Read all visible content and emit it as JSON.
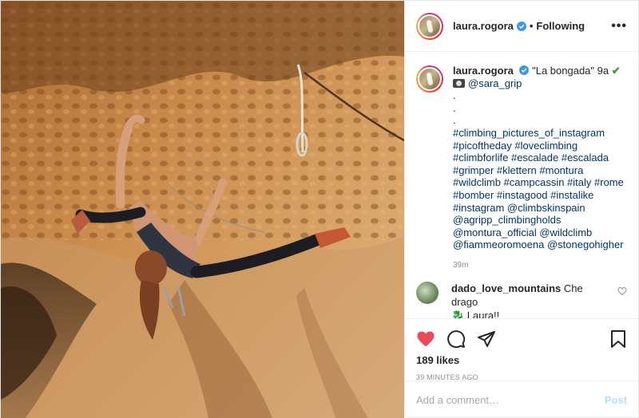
{
  "post": {
    "username": "laura.rogora",
    "separator": "•",
    "following_label": "Following",
    "more_label": "•••"
  },
  "caption": {
    "username": "laura.rogora",
    "title": "\"La bongada\" 9a",
    "check": "✔",
    "credit": "@sara_grip",
    "dots": [
      ".",
      ".",
      "."
    ],
    "hashtags": [
      "#climbing_pictures_of_instagram",
      "#picoftheday #loveclimbing",
      "#climbforlife #escalade #escalada",
      "#grimper #klettern #montura",
      "#wildclimb #campcassin #italy #rome",
      "#bomber #instagood #instalike",
      "#instagram @climbskinspain",
      "@agripp_climbingholds",
      "@montura_official @wildclimb",
      "@fiammeoromoena @stonegohigher"
    ],
    "time": "39m"
  },
  "comment": {
    "username": "dado_love_mountains",
    "text": "Che drago",
    "text2": "🐉 Laura!!"
  },
  "actions": {
    "likes": "189 likes",
    "ago": "39 minutes ago",
    "liked_color": "#ed4956"
  },
  "add_comment": {
    "placeholder": "Add a comment…",
    "post_label": "Post"
  },
  "colors": {
    "link": "#00376b",
    "verified": "#3897f0",
    "post_button": "#b2dffc"
  }
}
